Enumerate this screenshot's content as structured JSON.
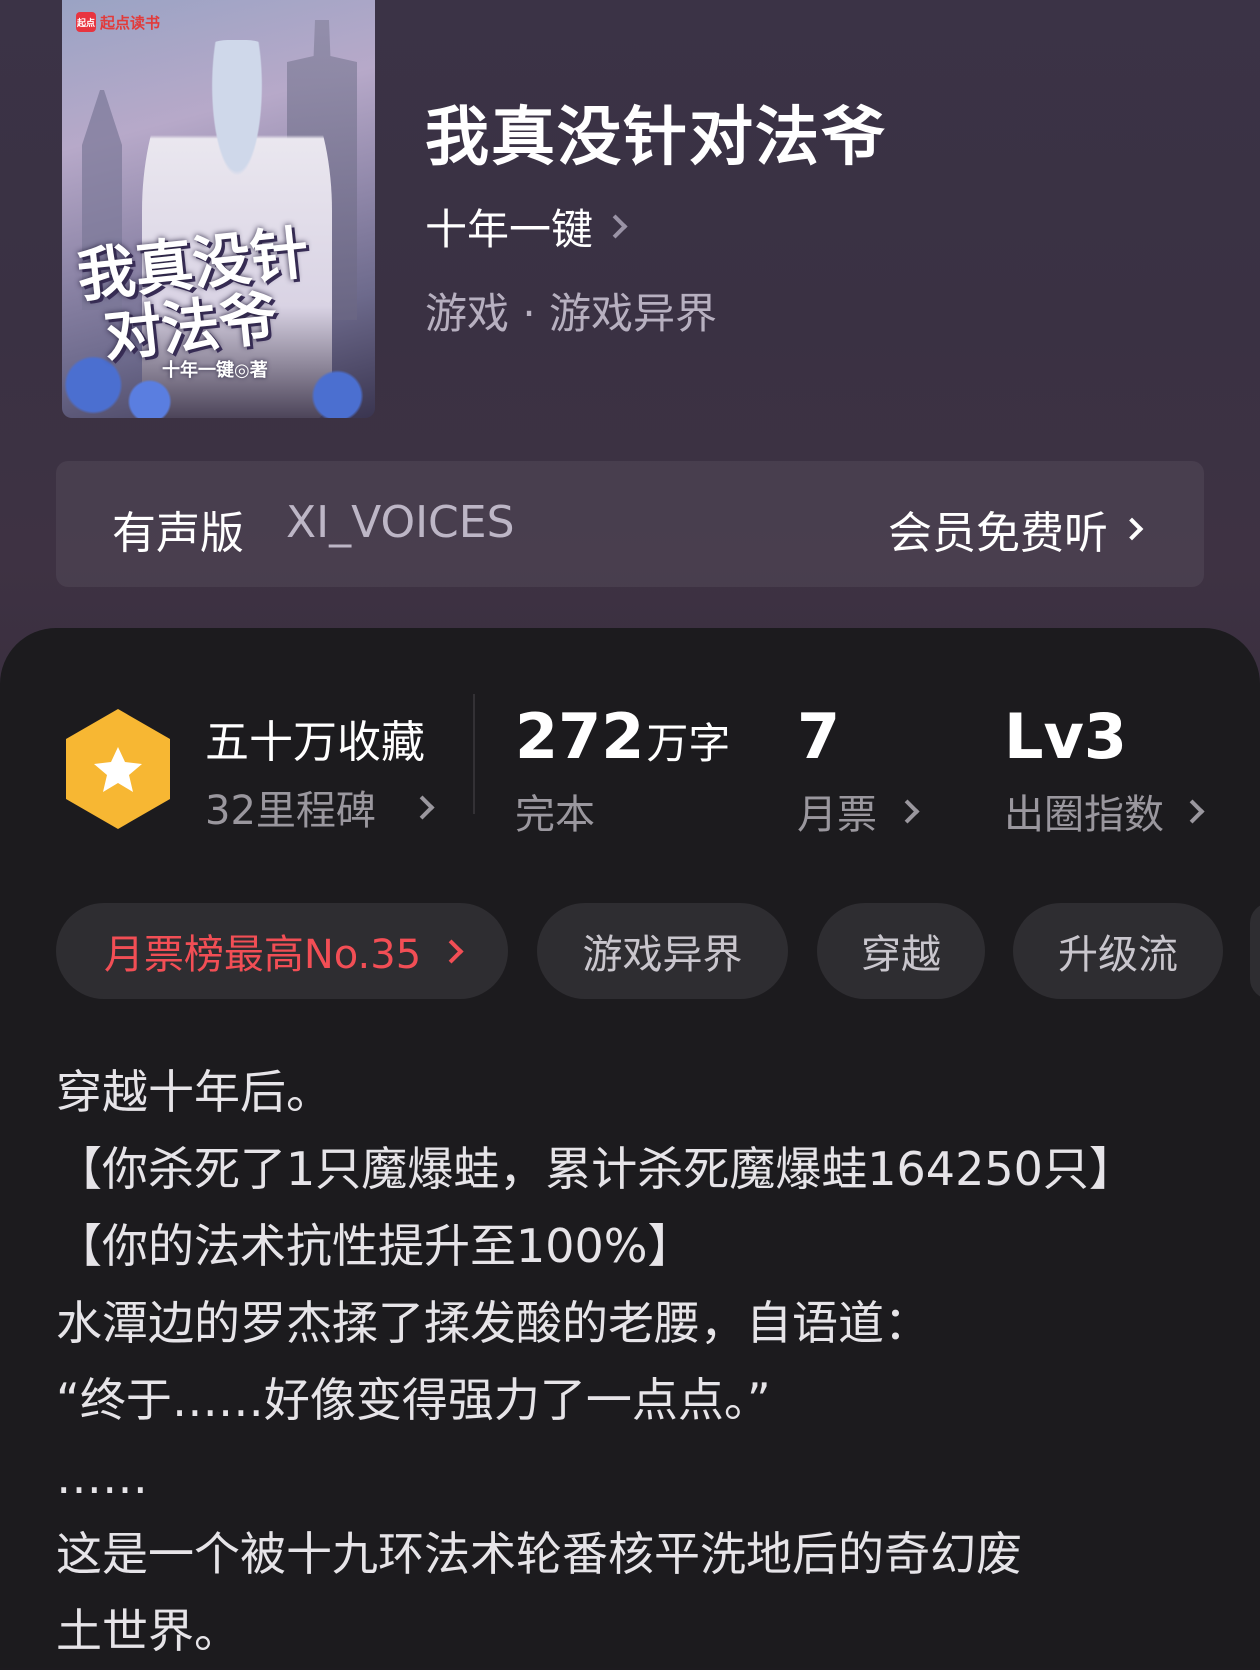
{
  "cover": {
    "brand": "起点读书",
    "brand_logo": "起点",
    "title_line1": "我真没针",
    "title_line2": "对法爷",
    "author": "十年一键◎著"
  },
  "book": {
    "title": "我真没针对法爷",
    "author": "十年一键",
    "genre": "游戏 · 游戏异界"
  },
  "audio": {
    "label": "有声版",
    "voice": "XI_VOICES",
    "action": "会员免费听"
  },
  "stats": {
    "favorites": "五十万收藏",
    "milestones": "32里程碑",
    "words_value": "272",
    "words_unit": "万字",
    "status": "完本",
    "monthly_votes_value": "7",
    "monthly_votes_label": "月票",
    "level_value": "Lv3",
    "level_label": "出圈指数"
  },
  "tags": [
    {
      "label": "月票榜最高No.35"
    },
    {
      "label": "游戏异界"
    },
    {
      "label": "穿越"
    },
    {
      "label": "升级流"
    }
  ],
  "description": [
    "穿越十年后。",
    "【你杀死了1只魔爆蛙，累计杀死魔爆蛙164250只】",
    "【你的法术抗性提升至100%】",
    "水潭边的罗杰揉了揉发酸的老腰，自语道：",
    "“终于……好像变得强力了一点点。”",
    "……",
    "这是一个被十九环法术轮番核平洗地后的奇幻废",
    "土世界。"
  ],
  "colors": {
    "hero_bg": "#3b3346",
    "panel_bg": "#1c1b1e",
    "accent_red": "#f24e55",
    "badge_gold": "#f7b733"
  },
  "icons": [
    "chevron-right-icon",
    "star-badge-icon"
  ]
}
